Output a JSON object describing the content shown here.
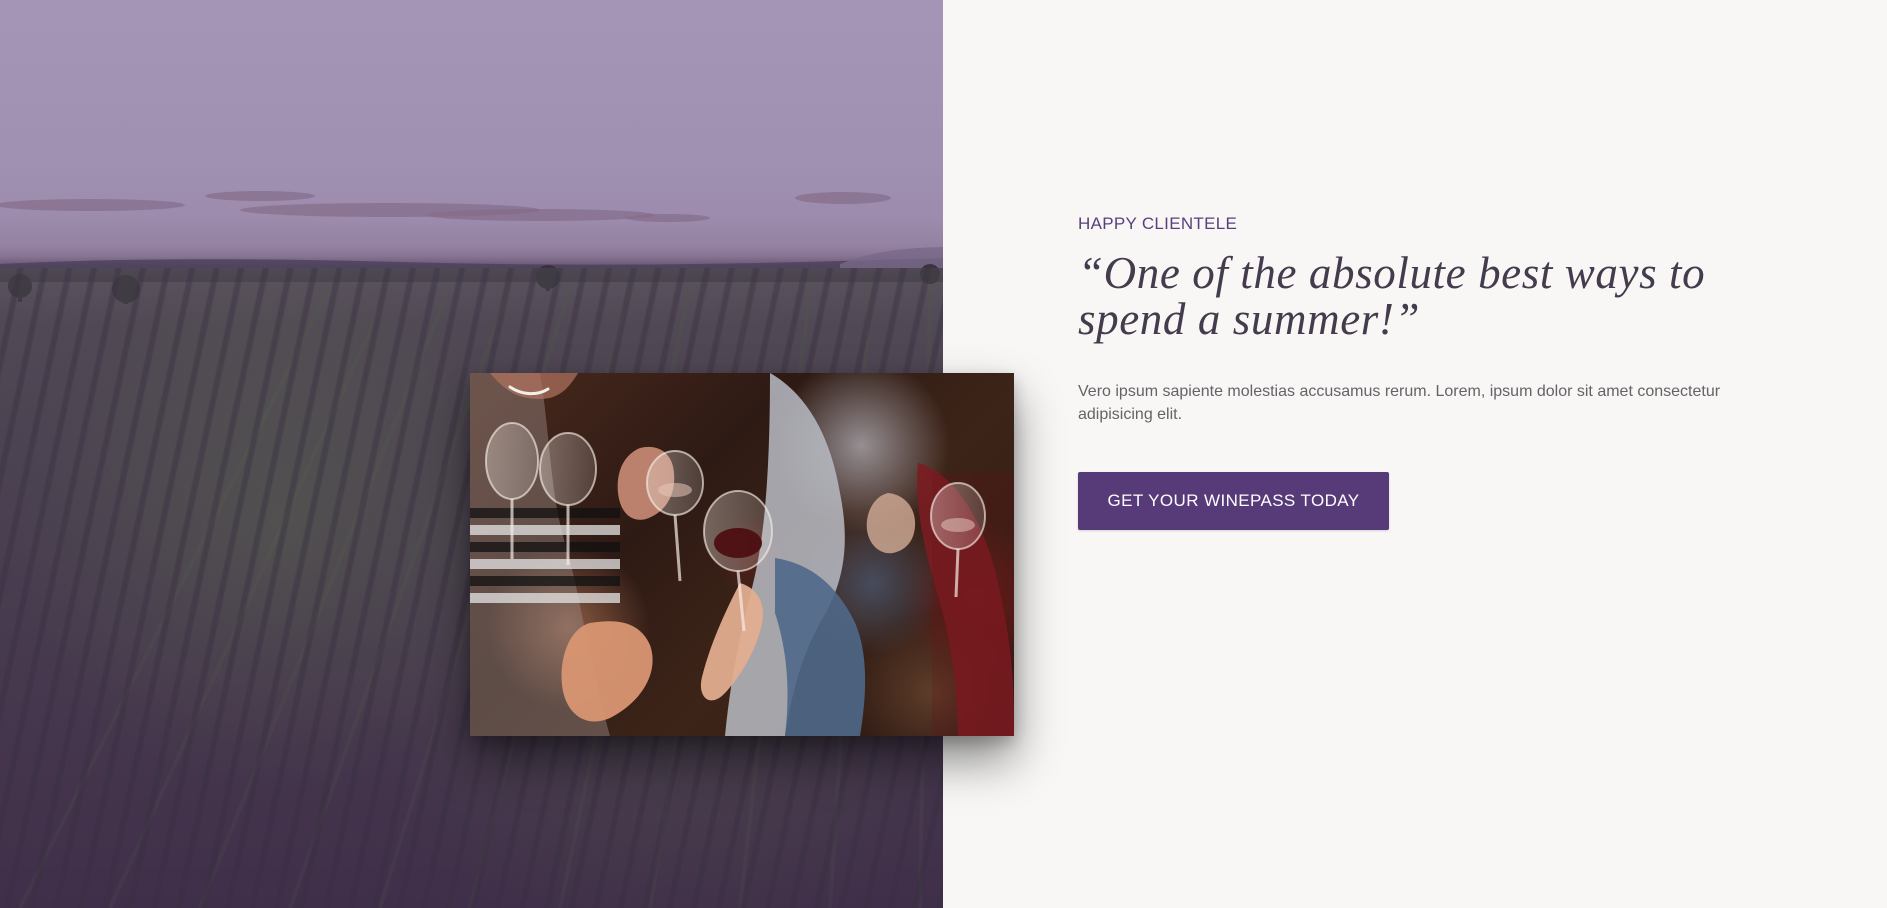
{
  "section": {
    "eyebrow": "HAPPY CLIENTELE",
    "quote": "“One of the absolute best ways to spend a summer!”",
    "description": "Vero ipsum sapiente molestias accusamus rerum. Lorem, ipsum dolor sit amet consectetur adipisicing elit.",
    "cta_label": "GET YOUR WINEPASS TODAY"
  },
  "theme": {
    "accent": "#573a78",
    "background": "#f8f7f5",
    "eyebrow_color": "#5a3f7c",
    "quote_color": "#443b4d",
    "body_text_color": "#666268"
  },
  "images": {
    "hero": "vineyard-image",
    "overlay": "wine-toast-photo"
  }
}
